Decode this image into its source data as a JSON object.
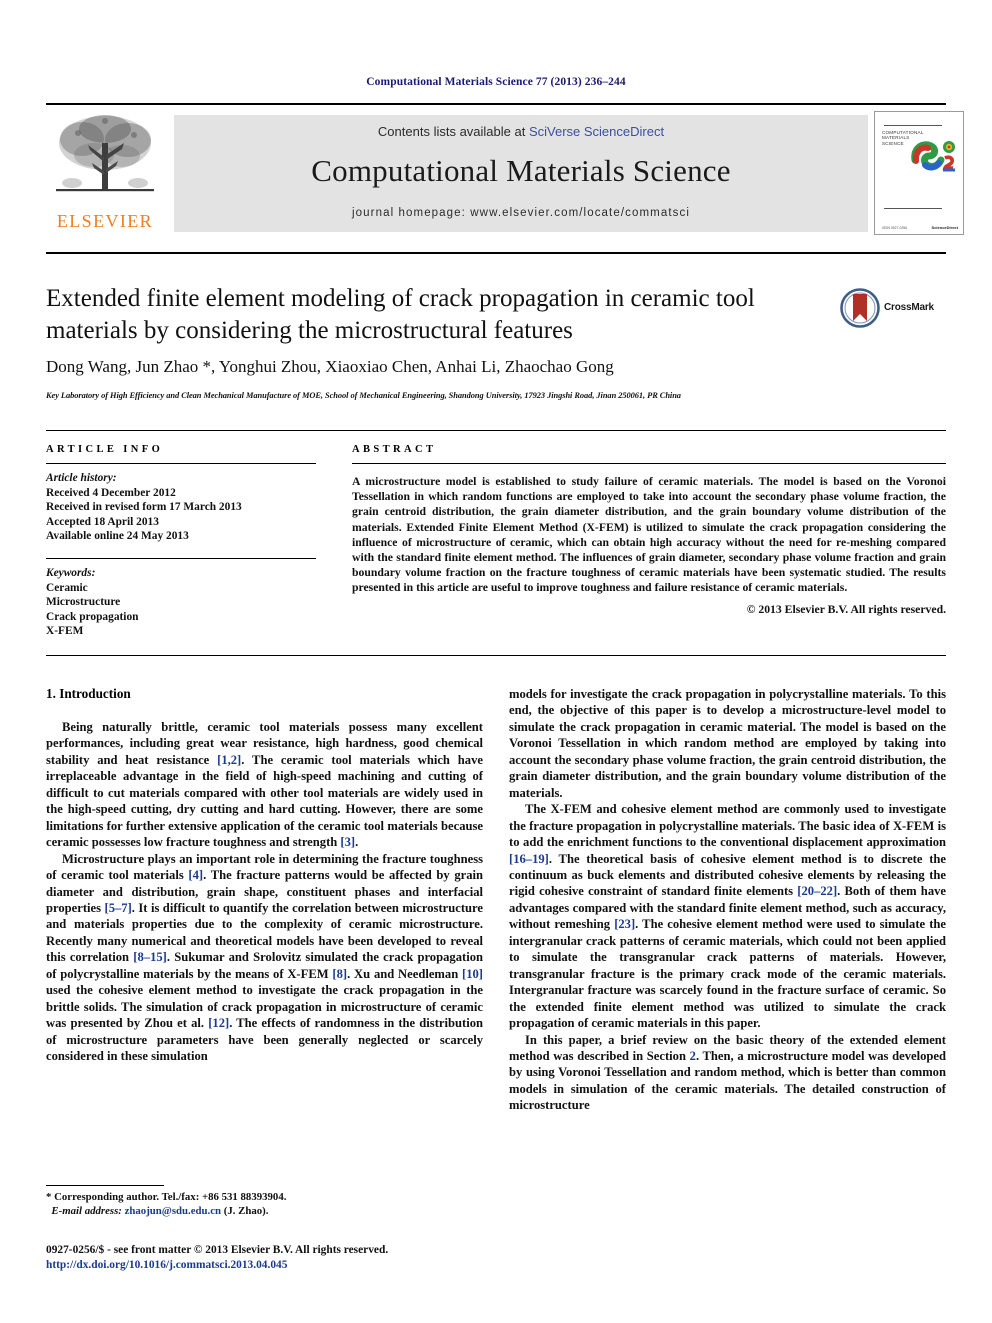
{
  "running_head": "Computational Materials Science 77 (2013) 236–244",
  "masthead": {
    "publisher": "ELSEVIER",
    "contents_prefix": "Contents lists available at ",
    "contents_link": "SciVerse ScienceDirect",
    "journal_title": "Computational Materials Science",
    "homepage": "journal homepage: www.elsevier.com/locate/commatsci",
    "cover": {
      "line1": "COMPUTATIONAL",
      "line2": "MATERIALS",
      "line3": "SCIENCE",
      "foot_left": "ISSN 0927-0256",
      "foot_right": "ScienceDirect"
    }
  },
  "article": {
    "title": "Extended finite element modeling of crack propagation in ceramic tool materials by considering the microstructural features",
    "crossmark_label": "CrossMark",
    "authors": "Dong Wang, Jun Zhao *, Yonghui Zhou, Xiaoxiao Chen, Anhai Li, Zhaochao Gong",
    "affiliation": "Key Laboratory of High Efficiency and Clean Mechanical Manufacture of MOE, School of Mechanical Engineering, Shandong University, 17923 Jingshi Road, Jinan 250061, PR China"
  },
  "article_info": {
    "heading": "ARTICLE INFO",
    "history_label": "Article history:",
    "history": [
      "Received 4 December 2012",
      "Received in revised form 17 March 2013",
      "Accepted 18 April 2013",
      "Available online 24 May 2013"
    ],
    "keywords_label": "Keywords:",
    "keywords": [
      "Ceramic",
      "Microstructure",
      "Crack propagation",
      "X-FEM"
    ]
  },
  "abstract": {
    "heading": "ABSTRACT",
    "text": "A microstructure model is established to study failure of ceramic materials. The model is based on the Voronoi Tessellation in which random functions are employed to take into account the secondary phase volume fraction, the grain centroid distribution, the grain diameter distribution, and the grain boundary volume distribution of the materials. Extended Finite Element Method (X-FEM) is utilized to simulate the crack propagation considering the influence of microstructure of ceramic, which can obtain high accuracy without the need for re-meshing compared with the standard finite element method. The influences of grain diameter, secondary phase volume fraction and grain boundary volume fraction on the fracture toughness of ceramic materials have been systematic studied. The results presented in this article are useful to improve toughness and failure resistance of ceramic materials.",
    "copyright": "© 2013 Elsevier B.V. All rights reserved."
  },
  "body": {
    "section_heading": "1. Introduction",
    "left_paragraphs": [
      "Being naturally brittle, ceramic tool materials possess many excellent performances, including great wear resistance, high hardness, good chemical stability and heat resistance [1,2]. The ceramic tool materials which have irreplaceable advantage in the field of high-speed machining and cutting of difficult to cut materials compared with other tool materials are widely used in the high-speed cutting, dry cutting and hard cutting. However, there are some limitations for further extensive application of the ceramic tool materials because ceramic possesses low fracture toughness and strength [3].",
      "Microstructure plays an important role in determining the fracture toughness of ceramic tool materials [4]. The fracture patterns would be affected by grain diameter and distribution, grain shape, constituent phases and interfacial properties [5–7]. It is difficult to quantify the correlation between microstructure and materials properties due to the complexity of ceramic microstructure. Recently many numerical and theoretical models have been developed to reveal this correlation [8–15]. Sukumar and Srolovitz simulated the crack propagation of polycrystalline materials by the means of X-FEM [8]. Xu and Needleman [10] used the cohesive element method to investigate the crack propagation in the brittle solids. The simulation of crack propagation in microstructure of ceramic was presented by Zhou et al. [12]. The effects of randomness in the distribution of microstructure parameters have been generally neglected or scarcely considered in these simulation"
    ],
    "right_paragraphs": [
      "models for investigate the crack propagation in polycrystalline materials. To this end, the objective of this paper is to develop a microstructure-level model to simulate the crack propagation in ceramic material. The model is based on the Voronoi Tessellation in which random method are employed by taking into account the secondary phase volume fraction, the grain centroid distribution, the grain diameter distribution, and the grain boundary volume distribution of the materials.",
      "The X-FEM and cohesive element method are commonly used to investigate the fracture propagation in polycrystalline materials. The basic idea of X-FEM is to add the enrichment functions to the conventional displacement approximation [16–19]. The theoretical basis of cohesive element method is to discrete the continuum as buck elements and distributed cohesive elements by releasing the rigid cohesive constraint of standard finite elements [20–22]. Both of them have advantages compared with the standard finite element method, such as accuracy, without remeshing [23]. The cohesive element method were used to simulate the intergranular crack patterns of ceramic materials, which could not been applied to simulate the transgranular crack patterns of materials. However, transgranular fracture is the primary crack mode of the ceramic materials. Intergranular fracture was scarcely found in the fracture surface of ceramic. So the extended finite element method was utilized to simulate the crack propagation of ceramic materials in this paper.",
      "In this paper, a brief review on the basic theory of the extended element method was described in Section 2. Then, a microstructure model was developed by using Voronoi Tessellation and random method, which is better than common models in simulation of the ceramic materials. The detailed construction of microstructure"
    ]
  },
  "footnotes": {
    "corresponding": "* Corresponding author. Tel./fax: +86 531 88393904.",
    "email_label": "E-mail address:",
    "email": "zhaojun@sdu.edu.cn",
    "email_suffix": "(J. Zhao)."
  },
  "footer": {
    "issn_line": "0927-0256/$ - see front matter © 2013 Elsevier B.V. All rights reserved.",
    "doi": "http://dx.doi.org/10.1016/j.commatsci.2013.04.045"
  },
  "colors": {
    "link_blue": "#1a3a8f",
    "elsevier_orange": "#ef7d20",
    "band_gray": "#e3e3e3",
    "runhead_navy": "#1a1a6e"
  }
}
